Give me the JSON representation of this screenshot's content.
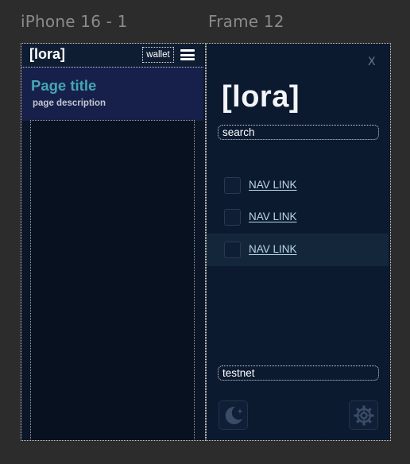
{
  "canvas": {
    "frames": [
      {
        "label": "iPhone 16 - 1"
      },
      {
        "label": "Frame 12"
      }
    ]
  },
  "left_frame": {
    "header": {
      "logo": "[lora]",
      "wallet_label": "wallet",
      "menu_icon": "hamburger-menu-icon"
    },
    "page": {
      "title": "Page title",
      "description": "page description"
    }
  },
  "right_frame": {
    "close_label": "X",
    "logo": "[lora]",
    "search": {
      "placeholder": "search",
      "value": ""
    },
    "nav_items": [
      {
        "label": "NAV LINK",
        "active": false
      },
      {
        "label": "NAV LINK",
        "active": false
      },
      {
        "label": "NAV LINK",
        "active": true
      }
    ],
    "network": {
      "value": "testnet"
    },
    "icons": {
      "theme": "moon-stars-icon",
      "settings": "gear-icon"
    }
  },
  "colors": {
    "canvas_bg": "#2c2c2c",
    "frame_bg": "#0b1628",
    "page_header_bg": "#16204a",
    "accent_title": "#45a6b5",
    "nav_link": "#b9d7e3",
    "nav_active_bg": "#14273a"
  }
}
